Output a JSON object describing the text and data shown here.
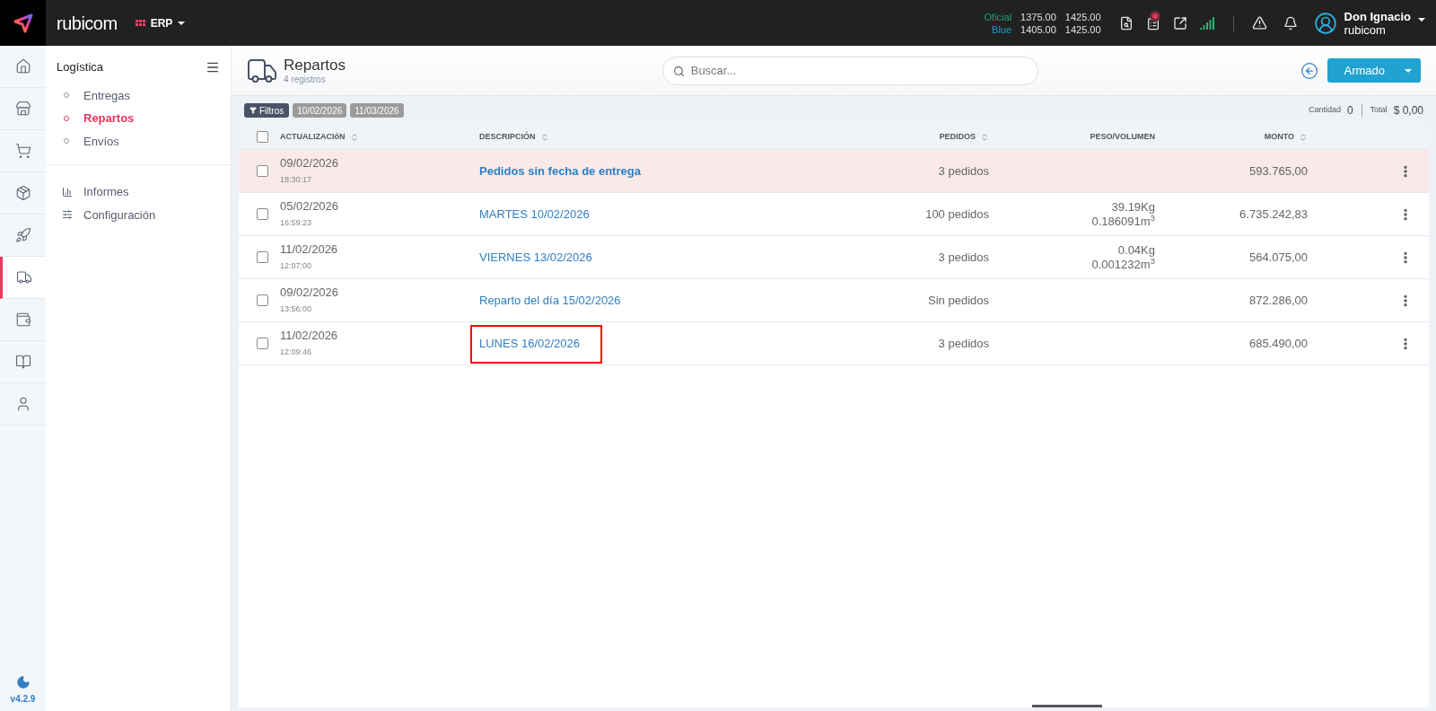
{
  "topbar": {
    "brand": "rubicom",
    "module": "ERP",
    "rates": [
      {
        "kind": "oficial",
        "label": "Oficial",
        "buy": "1375.00",
        "sell": "1425.00"
      },
      {
        "kind": "blue",
        "label": "Blue",
        "buy": "1405.00",
        "sell": "1425.00"
      }
    ],
    "notification_dot": true,
    "user": {
      "name": "Don Ignacio",
      "company": "rubicom"
    }
  },
  "rail": {
    "items": [
      {
        "selected": false
      },
      {
        "selected": false
      },
      {
        "selected": false
      },
      {
        "selected": false
      },
      {
        "selected": false
      },
      {
        "selected": true
      },
      {
        "selected": false
      },
      {
        "selected": false
      },
      {
        "selected": false
      }
    ],
    "version": "v4.2.9"
  },
  "sidebar": {
    "title": "Logística",
    "items": [
      {
        "label": "Entregas",
        "selected": false
      },
      {
        "label": "Repartos",
        "selected": true
      },
      {
        "label": "Envíos",
        "selected": false
      }
    ],
    "links": [
      {
        "label": "Informes"
      },
      {
        "label": "Configuración"
      }
    ]
  },
  "page": {
    "title": "Repartos",
    "subtitle": "4 registros",
    "search": {
      "placeholder": "Buscar..."
    },
    "action_button": "Armado"
  },
  "filters": {
    "button": "Filtros",
    "chips": [
      "10/02/2026",
      "11/03/2026"
    ],
    "quantity_label": "Cantidad",
    "quantity": "0",
    "total_label": "Total",
    "total": "$ 0,00"
  },
  "table": {
    "all_checked": false,
    "columns": [
      {
        "label": "ACTUALIZACIóN",
        "sortable": true
      },
      {
        "label": "DESCRIPCIÓN",
        "sortable": true
      },
      {
        "label": "PEDIDOS",
        "sortable": true
      },
      {
        "label": "PESO/VOLUMEN",
        "sortable": false
      },
      {
        "label": "MONTO",
        "sortable": true
      }
    ],
    "rows": [
      {
        "date": "09/02/2026",
        "time": "18:30:17",
        "description": "Pedidos sin fecha de entrega",
        "orders": "3 pedidos",
        "weight": "",
        "volume": "",
        "amount": "593.765,00",
        "warning": true,
        "marked": false,
        "checked": false
      },
      {
        "date": "05/02/2026",
        "time": "16:59:23",
        "description": "MARTES 10/02/2026",
        "orders": "100 pedidos",
        "weight": "39.19Kg",
        "volume": "0.186091m$^{3}$",
        "amount": "6.735.242,83",
        "warning": false,
        "marked": false,
        "checked": false
      },
      {
        "date": "11/02/2026",
        "time": "12:07:00",
        "description": "VIERNES 13/02/2026",
        "orders": "3 pedidos",
        "weight": "0.04Kg",
        "volume": "0.001232m$^{3}$",
        "amount": "564.075,00",
        "warning": false,
        "marked": false,
        "checked": false
      },
      {
        "date": "09/02/2026",
        "time": "13:56:00",
        "description": "Reparto del día 15/02/2026",
        "orders": "Sin pedidos",
        "weight": "",
        "volume": "",
        "amount": "872.286,00",
        "warning": false,
        "marked": false,
        "checked": false
      },
      {
        "date": "11/02/2026",
        "time": "12:09:46",
        "description": "LUNES 16/02/2026",
        "orders": "3 pedidos",
        "weight": "",
        "volume": "",
        "amount": "685.490,00",
        "warning": false,
        "marked": true,
        "checked": false
      }
    ]
  }
}
